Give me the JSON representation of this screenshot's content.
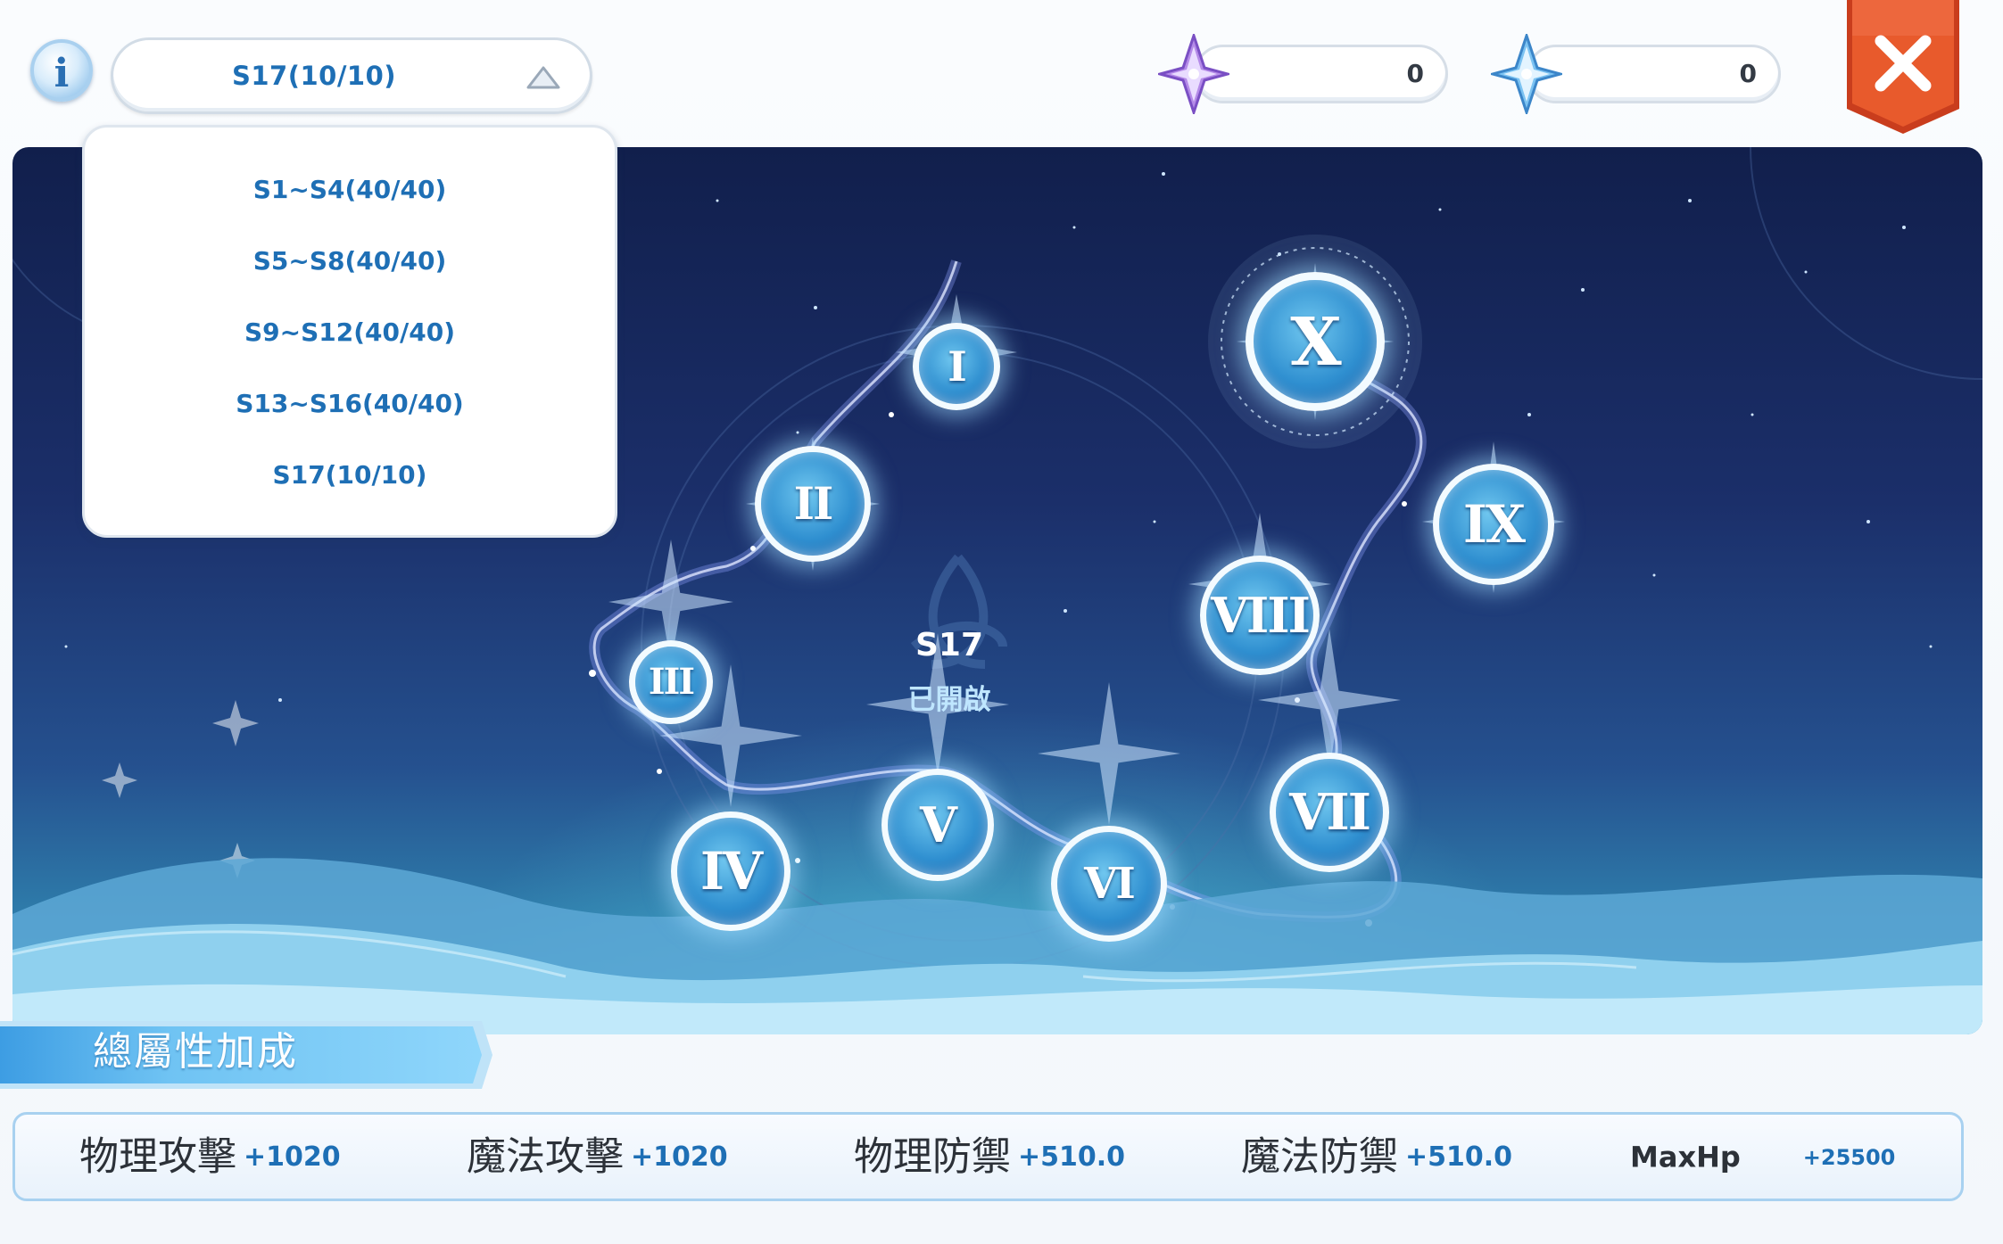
{
  "top_bar": {
    "info_glyph": "i",
    "selected_stage": "S17(10/10)",
    "currency_1": {
      "icon": "purple-star-crystal-icon",
      "amount": "0"
    },
    "currency_2": {
      "icon": "blue-star-crystal-icon",
      "amount": "0"
    }
  },
  "dropdown": {
    "items": [
      {
        "label": "S1~S4(40/40)"
      },
      {
        "label": "S5~S8(40/40)"
      },
      {
        "label": "S9~S12(40/40)"
      },
      {
        "label": "S13~S16(40/40)"
      },
      {
        "label": "S17(10/10)"
      }
    ]
  },
  "constellation": {
    "title": "S17",
    "status": "已開啟",
    "nodes": [
      {
        "label": "I"
      },
      {
        "label": "II"
      },
      {
        "label": "III"
      },
      {
        "label": "IV"
      },
      {
        "label": "V"
      },
      {
        "label": "VI"
      },
      {
        "label": "VII"
      },
      {
        "label": "VIII"
      },
      {
        "label": "IX"
      },
      {
        "label": "X"
      }
    ]
  },
  "bonus": {
    "heading": "總屬性加成",
    "stats": [
      {
        "label": "物理攻擊",
        "value": "+1020"
      },
      {
        "label": "魔法攻擊",
        "value": "+1020"
      },
      {
        "label": "物理防禦",
        "value": "+510.0"
      },
      {
        "label": "魔法防禦",
        "value": "+510.0"
      },
      {
        "label": "MaxHp",
        "value": "+25500"
      }
    ]
  },
  "colors": {
    "accent_blue": "#1e6fb5",
    "close_red": "#e2552a",
    "sky_top": "#111f4c",
    "horizon_cyan": "#5ed6ea"
  }
}
